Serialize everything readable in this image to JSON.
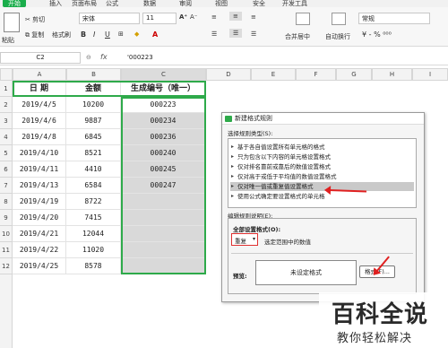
{
  "ribbon": {
    "tabs": [
      "开始",
      "插入",
      "页面布局",
      "公式",
      "数据",
      "审阅",
      "视图",
      "安全",
      "开发工具"
    ],
    "cut": "剪切",
    "copy": "复制",
    "format_painter": "格式刷",
    "paste": "粘贴",
    "font": "宋体",
    "font_size": "11",
    "merge": "合并居中",
    "wrap": "自动换行",
    "number_format": "常规"
  },
  "formula_bar": {
    "name_box": "C2",
    "fx": "fx",
    "content": "'000223"
  },
  "sheet": {
    "columns": [
      "A",
      "B",
      "C",
      "D",
      "E",
      "F",
      "G",
      "H",
      "I"
    ],
    "rows": [
      "1",
      "2",
      "3",
      "4",
      "5",
      "6",
      "7",
      "8",
      "9",
      "10",
      "11",
      "12"
    ],
    "headers": [
      "日 期",
      "金额",
      "生成编号（唯一）"
    ],
    "data": [
      [
        "2019/4/5",
        "10200",
        "000223"
      ],
      [
        "2019/4/6",
        "9887",
        "000234"
      ],
      [
        "2019/4/8",
        "6845",
        "000236"
      ],
      [
        "2019/4/10",
        "8521",
        "000240"
      ],
      [
        "2019/4/11",
        "4410",
        "000245"
      ],
      [
        "2019/4/13",
        "6584",
        "000247"
      ],
      [
        "2019/4/19",
        "8722",
        ""
      ],
      [
        "2019/4/20",
        "7415",
        ""
      ],
      [
        "2019/4/21",
        "12044",
        ""
      ],
      [
        "2019/4/22",
        "11020",
        ""
      ],
      [
        "2019/4/25",
        "8578",
        ""
      ]
    ]
  },
  "dialog": {
    "title": "新建格式规则",
    "select_type_label": "选择规则类型(S):",
    "rules": [
      "基于各自值设置所有单元格的格式",
      "只为包含以下内容的单元格设置格式",
      "仅对排名靠前或靠后的数值设置格式",
      "仅对高于或低于平均值的数值设置格式",
      "仅对唯一值或重复值设置格式",
      "使用公式确定要设置格式的单元格"
    ],
    "selected_rule_index": 4,
    "edit_label": "编辑规则说明(E):",
    "format_all_label": "全部设置格式(O):",
    "dropdown_value": "重复",
    "dropdown_suffix": "选定范围中的数值",
    "preview_label": "预览:",
    "preview_text": "未设定格式",
    "format_button": "格式(F)..."
  },
  "watermark": {
    "main": "百科全说",
    "sub": "教你轻松解决"
  },
  "colors": {
    "accent_green": "#1aad4b",
    "highlight_border": "#2eaa4a",
    "annotation_red": "#e02020"
  }
}
